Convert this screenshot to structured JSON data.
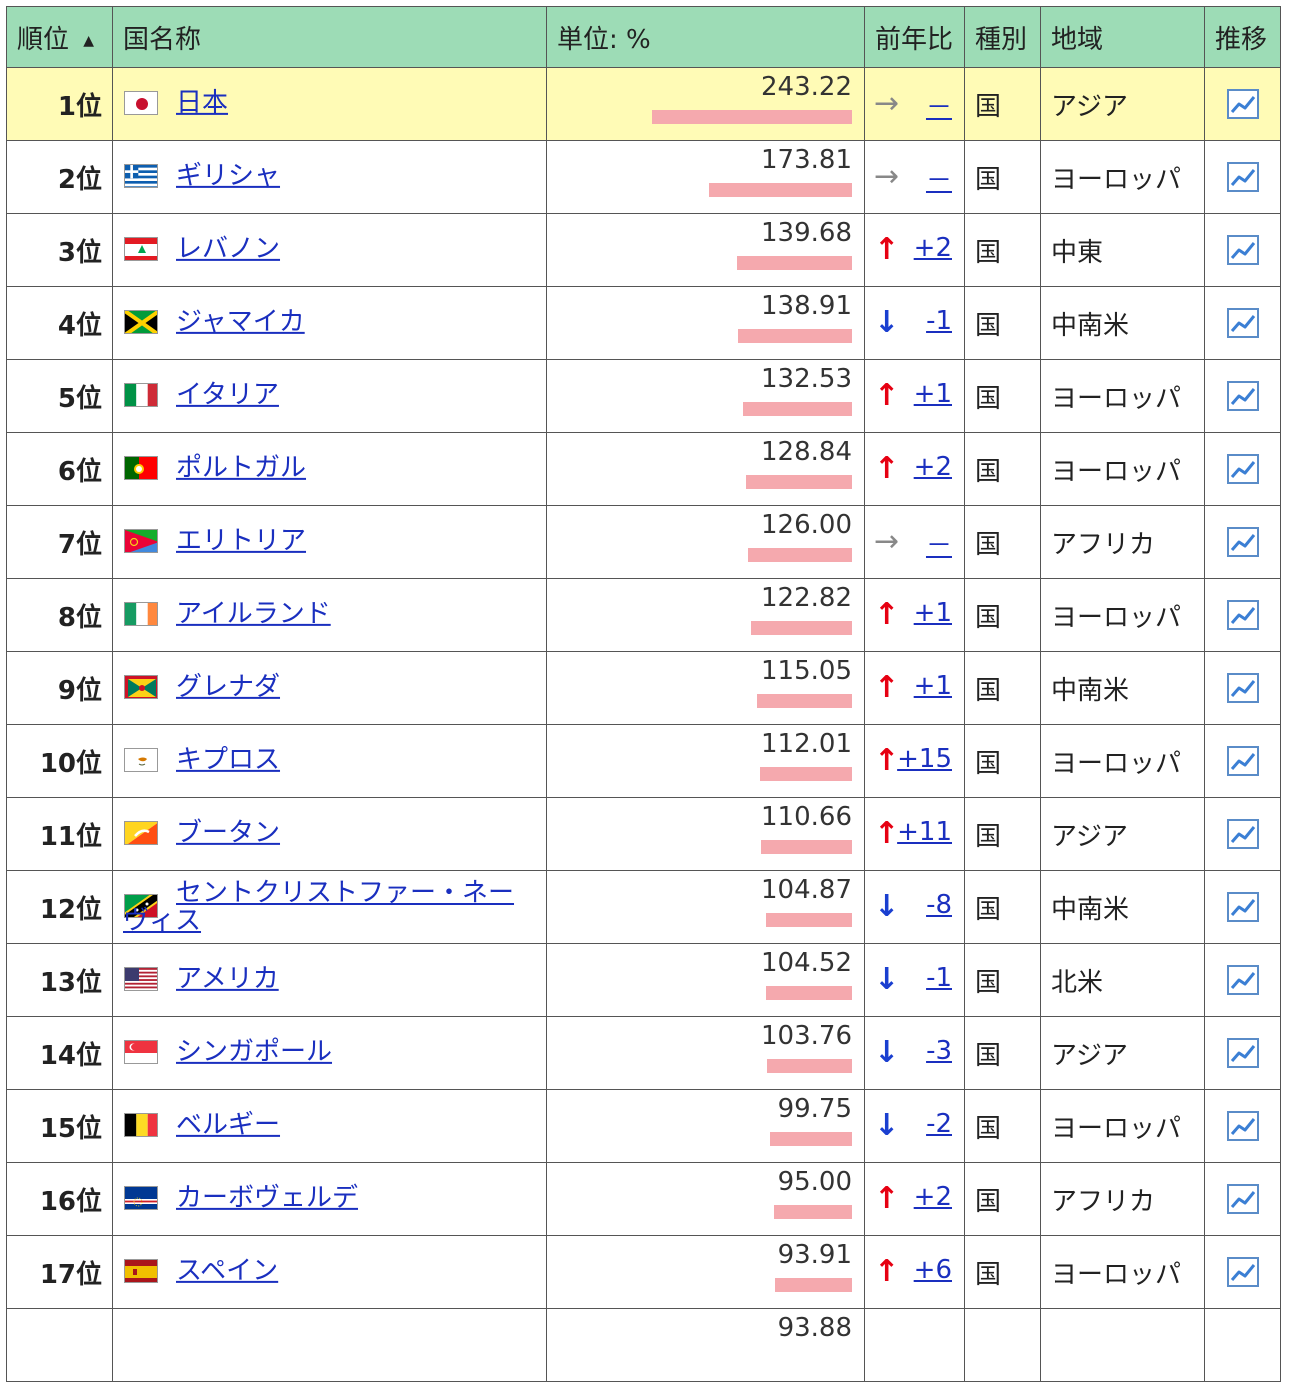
{
  "header": {
    "rank": "順位",
    "rank_sort_icon": "sort-up-triangle",
    "name": "国名称",
    "unit": "単位: %",
    "change": "前年比",
    "kind": "種別",
    "region": "地域",
    "trend": "推移"
  },
  "colors": {
    "header_bg": "#9ddcb6",
    "highlight_row_bg": "#fffbb6",
    "bar": "#f5a9ae",
    "link": "#1a2fbf",
    "arrow_up": "#e60012",
    "arrow_down": "#1a3fd0",
    "arrow_flat": "#888888"
  },
  "max_value": 243.22,
  "rows": [
    {
      "rank": "1位",
      "country": "日本",
      "value": "243.22",
      "dir": "flat",
      "change": "－",
      "kind": "国",
      "region": "アジア",
      "flag": "jp"
    },
    {
      "rank": "2位",
      "country": "ギリシャ",
      "value": "173.81",
      "dir": "flat",
      "change": "－",
      "kind": "国",
      "region": "ヨーロッパ",
      "flag": "gr"
    },
    {
      "rank": "3位",
      "country": "レバノン",
      "value": "139.68",
      "dir": "up",
      "change": "+2",
      "kind": "国",
      "region": "中東",
      "flag": "lb"
    },
    {
      "rank": "4位",
      "country": "ジャマイカ",
      "value": "138.91",
      "dir": "down",
      "change": "-1",
      "kind": "国",
      "region": "中南米",
      "flag": "jm"
    },
    {
      "rank": "5位",
      "country": "イタリア",
      "value": "132.53",
      "dir": "up",
      "change": "+1",
      "kind": "国",
      "region": "ヨーロッパ",
      "flag": "it"
    },
    {
      "rank": "6位",
      "country": "ポルトガル",
      "value": "128.84",
      "dir": "up",
      "change": "+2",
      "kind": "国",
      "region": "ヨーロッパ",
      "flag": "pt"
    },
    {
      "rank": "7位",
      "country": "エリトリア",
      "value": "126.00",
      "dir": "flat",
      "change": "－",
      "kind": "国",
      "region": "アフリカ",
      "flag": "er"
    },
    {
      "rank": "8位",
      "country": "アイルランド",
      "value": "122.82",
      "dir": "up",
      "change": "+1",
      "kind": "国",
      "region": "ヨーロッパ",
      "flag": "ie"
    },
    {
      "rank": "9位",
      "country": "グレナダ",
      "value": "115.05",
      "dir": "up",
      "change": "+1",
      "kind": "国",
      "region": "中南米",
      "flag": "gd"
    },
    {
      "rank": "10位",
      "country": "キプロス",
      "value": "112.01",
      "dir": "up",
      "change": "+15",
      "kind": "国",
      "region": "ヨーロッパ",
      "flag": "cy"
    },
    {
      "rank": "11位",
      "country": "ブータン",
      "value": "110.66",
      "dir": "up",
      "change": "+11",
      "kind": "国",
      "region": "アジア",
      "flag": "bt"
    },
    {
      "rank": "12位",
      "country": "セントクリストファー・ネーヴィス",
      "value": "104.87",
      "dir": "down",
      "change": "-8",
      "kind": "国",
      "region": "中南米",
      "flag": "kn"
    },
    {
      "rank": "13位",
      "country": "アメリカ",
      "value": "104.52",
      "dir": "down",
      "change": "-1",
      "kind": "国",
      "region": "北米",
      "flag": "us"
    },
    {
      "rank": "14位",
      "country": "シンガポール",
      "value": "103.76",
      "dir": "down",
      "change": "-3",
      "kind": "国",
      "region": "アジア",
      "flag": "sg"
    },
    {
      "rank": "15位",
      "country": "ベルギー",
      "value": "99.75",
      "dir": "down",
      "change": "-2",
      "kind": "国",
      "region": "ヨーロッパ",
      "flag": "be"
    },
    {
      "rank": "16位",
      "country": "カーボヴェルデ",
      "value": "95.00",
      "dir": "up",
      "change": "+2",
      "kind": "国",
      "region": "アフリカ",
      "flag": "cv"
    },
    {
      "rank": "17位",
      "country": "スペイン",
      "value": "93.91",
      "dir": "up",
      "change": "+6",
      "kind": "国",
      "region": "ヨーロッパ",
      "flag": "es"
    }
  ],
  "partial_row": {
    "value": "93.88"
  }
}
